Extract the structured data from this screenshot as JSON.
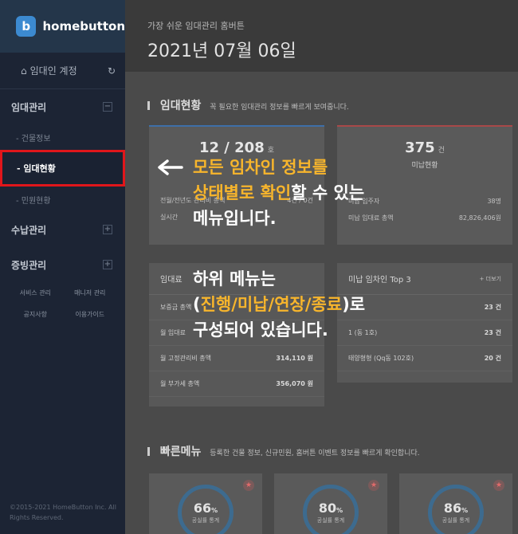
{
  "sidebar": {
    "logo_mark": "b",
    "logo_text": "homebutton",
    "account": "임대인 계정",
    "sections": [
      {
        "label": "임대관리",
        "sub": [
          "- 건물정보",
          "- 임대현황",
          "- 민원현황"
        ]
      },
      {
        "label": "수납관리"
      },
      {
        "label": "증빙관리"
      }
    ],
    "grid_menu": [
      "서비스 관리",
      "매니저 관리",
      "공지사항",
      "이용가이드"
    ],
    "copyright_line1": "©2015-2021 HomeButton Inc. All",
    "copyright_line2": "Rights Reserved."
  },
  "header": {
    "subtitle": "가장 쉬운 임대관리 홈버튼",
    "date": "2021년 07월 06일"
  },
  "status_section": {
    "title": "임대현황",
    "desc": "꼭 필요한 임대관리 정보를 빠르게 보여줍니다."
  },
  "card_left": {
    "value": "12 / 208",
    "unit": "호",
    "row1_label": "전월/전년도 관리비 총액",
    "row1_value": "4건 / 0건",
    "row2_label": "실시간"
  },
  "card_right": {
    "value": "375",
    "unit": "건",
    "caption": "미납현황",
    "row1_label": "미납 입주자",
    "row1_value": "38명",
    "row2_label": "미납 임대료 총액",
    "row2_value": "82,826,406원"
  },
  "table_left": {
    "title": "임대료",
    "rows": [
      {
        "label": "보증금 총액",
        "value": ""
      },
      {
        "label": "월 임대료",
        "value": ""
      },
      {
        "label": "월 고정관리비 총액",
        "value": "314,110 원"
      },
      {
        "label": "월 부가세 총액",
        "value": "356,070 원"
      }
    ]
  },
  "table_right": {
    "title": "미납 임차인 Top 3",
    "more": "+ 더보기",
    "rows": [
      {
        "label": "",
        "value": "23 건"
      },
      {
        "label": "1 (동 1호)",
        "value": "23 건"
      },
      {
        "label": "태양형형 (Qq동 102호)",
        "value": "20 건"
      }
    ]
  },
  "quick_section": {
    "title": "빠른메뉴",
    "desc": "등록한 건물 정보, 신규민원, 홈버튼 이벤트 정보를 빠르게 확인합니다.",
    "cards": [
      {
        "value": "66",
        "unit": "%",
        "caption": "공실률 통계"
      },
      {
        "value": "80",
        "unit": "%",
        "caption": "공실률 통계"
      },
      {
        "value": "86",
        "unit": "%",
        "caption": "공실률 통계"
      }
    ]
  },
  "callout": {
    "l1_hl": "모든 임차인 정보를",
    "l2_hl": "상태별로 확인",
    "l2_rest": "할 수 있는",
    "l3": "메뉴입니다.",
    "l4": "하위 메뉴는",
    "l5_open": "(",
    "l5_hl": "진행/미납/연장/종료",
    "l5_close": ")로",
    "l6": "구성되어 있습니다."
  },
  "colors": {
    "highlight": "#f7b52c",
    "active_border": "#e0161b",
    "sidebar_bg": "#1c2434"
  }
}
